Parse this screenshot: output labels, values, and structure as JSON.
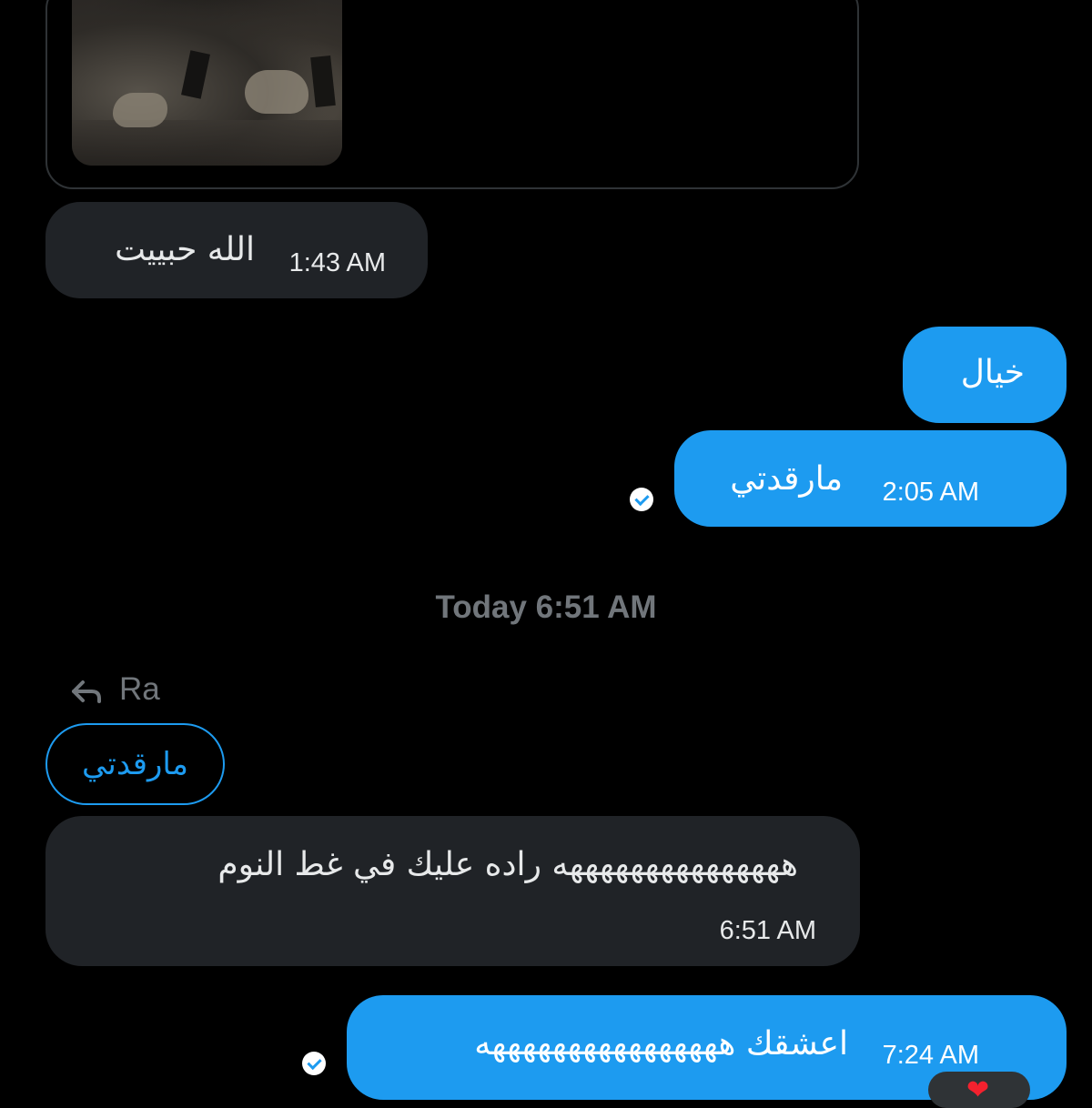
{
  "conversation": {
    "messages": [
      {
        "id": "m1",
        "direction": "incoming",
        "text": "الله حبييت",
        "time": "1:43 AM",
        "has_media": true
      },
      {
        "id": "m2",
        "direction": "outgoing",
        "text": "خيال"
      },
      {
        "id": "m3",
        "direction": "outgoing",
        "text": "مارقدتي",
        "time": "2:05 AM",
        "status": "read"
      },
      {
        "id": "m4",
        "direction": "incoming",
        "reply_to_name": "Ra",
        "quoted_text": "مارقدتي",
        "text": "هههههههههههههههه راده عليك في غط النوم",
        "time": "6:51 AM"
      },
      {
        "id": "m5",
        "direction": "outgoing",
        "text": "اعشقك ههههههههههههههههه",
        "time": "7:24 AM",
        "status": "read",
        "reaction": "❤"
      }
    ],
    "day_separator": "Today 6:51 AM"
  },
  "colors": {
    "background": "#000000",
    "incoming_bubble": "#202327",
    "outgoing_bubble": "#1d9bf0",
    "muted_text": "#71767b",
    "accent": "#1d9bf0"
  },
  "icons": {
    "reply": "reply-arrow-icon",
    "read_receipt": "check-circle-icon",
    "reaction": "heart-icon"
  }
}
